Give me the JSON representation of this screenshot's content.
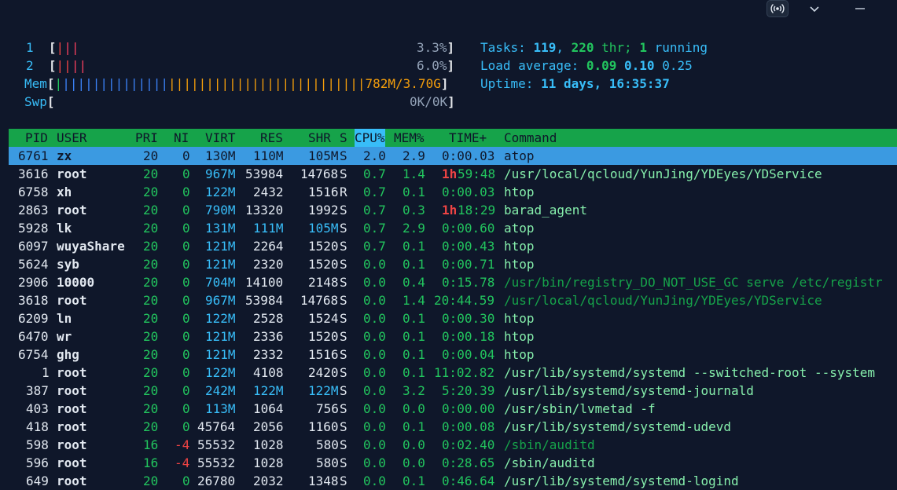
{
  "window_controls": {
    "icons": [
      "broadcast-icon",
      "chevron-down-icon",
      "minimize-icon"
    ]
  },
  "meters": {
    "cpu1": {
      "label": "1",
      "bars_red": "|",
      "bars_pink": "||",
      "value": "3.3%"
    },
    "cpu2": {
      "label": "2",
      "bars_red": "||",
      "bars_pink": "||",
      "value": "6.0%"
    },
    "mem": {
      "label": "Mem",
      "bars_green": "|",
      "bars_blue": "||||||||||||||",
      "bars_orange": "||||||||||||||||||||||||||",
      "value": "782M/3.70G"
    },
    "swp": {
      "label": "Swp",
      "value": "0K/0K"
    }
  },
  "summary": {
    "tasks_label": "Tasks: ",
    "tasks": "119",
    "thr_sep": ", ",
    "thr": "220",
    "thr_label": " thr; ",
    "running": "1",
    "running_label": " running",
    "load_label": "Load average: ",
    "load1": "0.09",
    "load5": "0.10",
    "load15": "0.25",
    "uptime_label": "Uptime: ",
    "uptime": "11 days, 16:35:37"
  },
  "columns": [
    "PID",
    "USER",
    "PRI",
    "NI",
    "VIRT",
    "RES",
    "SHR",
    "S",
    "CPU%",
    "MEM%",
    "TIME+",
    "Command"
  ],
  "processes": [
    {
      "pid": "6761",
      "user": "zx",
      "pri": "20",
      "ni": "0",
      "virt": "130M",
      "res": "110M",
      "shr": "105M",
      "s": "S",
      "cpu": "2.0",
      "mem": "2.9",
      "time_h": "",
      "time": "0:00.03",
      "cmd": "atop",
      "cmd_thread": false
    },
    {
      "pid": "3616",
      "user": "root",
      "pri": "20",
      "ni": "0",
      "virt": "967M",
      "res": "53984",
      "shr": "14768",
      "s": "S",
      "cpu": "0.7",
      "mem": "1.4",
      "time_h": "1h",
      "time": "59:48",
      "cmd": "/usr/local/qcloud/YunJing/YDEyes/YDService",
      "cmd_thread": false
    },
    {
      "pid": "6758",
      "user": "xh",
      "pri": "20",
      "ni": "0",
      "virt": "122M",
      "res": "2432",
      "shr": "1516",
      "s": "R",
      "cpu": "0.7",
      "mem": "0.1",
      "time_h": "",
      "time": "0:00.03",
      "cmd": "htop",
      "cmd_thread": false
    },
    {
      "pid": "2863",
      "user": "root",
      "pri": "20",
      "ni": "0",
      "virt": "790M",
      "res": "13320",
      "shr": "1992",
      "s": "S",
      "cpu": "0.7",
      "mem": "0.3",
      "time_h": "1h",
      "time": "18:29",
      "cmd": "barad_agent",
      "cmd_thread": false
    },
    {
      "pid": "5928",
      "user": "lk",
      "pri": "20",
      "ni": "0",
      "virt": "131M",
      "res": "111M",
      "shr": "105M",
      "s": "S",
      "cpu": "0.7",
      "mem": "2.9",
      "time_h": "",
      "time": "0:00.60",
      "cmd": "atop",
      "cmd_thread": false
    },
    {
      "pid": "6097",
      "user": "wuyaShare",
      "pri": "20",
      "ni": "0",
      "virt": "121M",
      "res": "2264",
      "shr": "1520",
      "s": "S",
      "cpu": "0.7",
      "mem": "0.1",
      "time_h": "",
      "time": "0:00.43",
      "cmd": "htop",
      "cmd_thread": false
    },
    {
      "pid": "5624",
      "user": "syb",
      "pri": "20",
      "ni": "0",
      "virt": "121M",
      "res": "2320",
      "shr": "1520",
      "s": "S",
      "cpu": "0.0",
      "mem": "0.1",
      "time_h": "",
      "time": "0:00.71",
      "cmd": "htop",
      "cmd_thread": false
    },
    {
      "pid": "2906",
      "user": "10000",
      "pri": "20",
      "ni": "0",
      "virt": "704M",
      "res": "14100",
      "shr": "2148",
      "s": "S",
      "cpu": "0.0",
      "mem": "0.4",
      "time_h": "",
      "time": "0:15.78",
      "cmd": "/usr/bin/registry_DO_NOT_USE_GC serve /etc/registr",
      "cmd_thread": true
    },
    {
      "pid": "3618",
      "user": "root",
      "pri": "20",
      "ni": "0",
      "virt": "967M",
      "res": "53984",
      "shr": "14768",
      "s": "S",
      "cpu": "0.0",
      "mem": "1.4",
      "time_h": "",
      "time": "20:44.59",
      "cmd": "/usr/local/qcloud/YunJing/YDEyes/YDService",
      "cmd_thread": true
    },
    {
      "pid": "6209",
      "user": "ln",
      "pri": "20",
      "ni": "0",
      "virt": "122M",
      "res": "2528",
      "shr": "1524",
      "s": "S",
      "cpu": "0.0",
      "mem": "0.1",
      "time_h": "",
      "time": "0:00.30",
      "cmd": "htop",
      "cmd_thread": false
    },
    {
      "pid": "6470",
      "user": "wr",
      "pri": "20",
      "ni": "0",
      "virt": "121M",
      "res": "2336",
      "shr": "1520",
      "s": "S",
      "cpu": "0.0",
      "mem": "0.1",
      "time_h": "",
      "time": "0:00.18",
      "cmd": "htop",
      "cmd_thread": false
    },
    {
      "pid": "6754",
      "user": "ghg",
      "pri": "20",
      "ni": "0",
      "virt": "121M",
      "res": "2332",
      "shr": "1516",
      "s": "S",
      "cpu": "0.0",
      "mem": "0.1",
      "time_h": "",
      "time": "0:00.04",
      "cmd": "htop",
      "cmd_thread": false
    },
    {
      "pid": "1",
      "user": "root",
      "pri": "20",
      "ni": "0",
      "virt": "122M",
      "res": "4108",
      "shr": "2420",
      "s": "S",
      "cpu": "0.0",
      "mem": "0.1",
      "time_h": "",
      "time": "11:02.82",
      "cmd": "/usr/lib/systemd/systemd --switched-root --system",
      "cmd_thread": false
    },
    {
      "pid": "387",
      "user": "root",
      "pri": "20",
      "ni": "0",
      "virt": "242M",
      "res": "122M",
      "shr": "122M",
      "s": "S",
      "cpu": "0.0",
      "mem": "3.2",
      "time_h": "",
      "time": "5:20.39",
      "cmd": "/usr/lib/systemd/systemd-journald",
      "cmd_thread": false
    },
    {
      "pid": "403",
      "user": "root",
      "pri": "20",
      "ni": "0",
      "virt": "113M",
      "res": "1064",
      "shr": "756",
      "s": "S",
      "cpu": "0.0",
      "mem": "0.0",
      "time_h": "",
      "time": "0:00.00",
      "cmd": "/usr/sbin/lvmetad -f",
      "cmd_thread": false
    },
    {
      "pid": "418",
      "user": "root",
      "pri": "20",
      "ni": "0",
      "virt": "45764",
      "res": "2056",
      "shr": "1160",
      "s": "S",
      "cpu": "0.0",
      "mem": "0.1",
      "time_h": "",
      "time": "0:00.08",
      "cmd": "/usr/lib/systemd/systemd-udevd",
      "cmd_thread": false
    },
    {
      "pid": "598",
      "user": "root",
      "pri": "16",
      "ni": "-4",
      "virt": "55532",
      "res": "1028",
      "shr": "580",
      "s": "S",
      "cpu": "0.0",
      "mem": "0.0",
      "time_h": "",
      "time": "0:02.40",
      "cmd": "/sbin/auditd",
      "cmd_thread": true
    },
    {
      "pid": "596",
      "user": "root",
      "pri": "16",
      "ni": "-4",
      "virt": "55532",
      "res": "1028",
      "shr": "580",
      "s": "S",
      "cpu": "0.0",
      "mem": "0.0",
      "time_h": "",
      "time": "0:28.65",
      "cmd": "/sbin/auditd",
      "cmd_thread": false
    },
    {
      "pid": "649",
      "user": "root",
      "pri": "20",
      "ni": "0",
      "virt": "26780",
      "res": "2032",
      "shr": "1348",
      "s": "S",
      "cpu": "0.0",
      "mem": "0.1",
      "time_h": "",
      "time": "0:46.64",
      "cmd": "/usr/lib/systemd/systemd-logind",
      "cmd_thread": false
    }
  ],
  "colors": {
    "background": "#0f172a",
    "header_bar": "#16a34a",
    "selected_row": "#3b9ae1",
    "accent_cyan": "#38bdf8",
    "accent_green": "#22c55e",
    "accent_red": "#ef4444",
    "accent_orange": "#f59e0b"
  }
}
